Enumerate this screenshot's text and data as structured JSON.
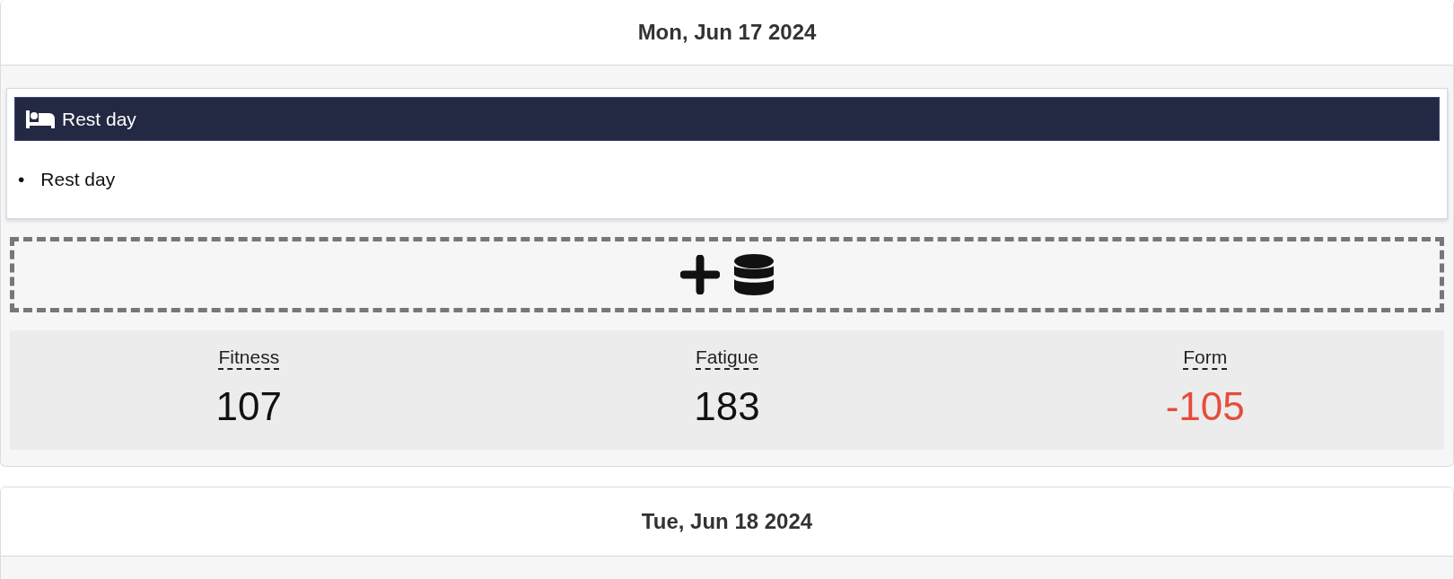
{
  "days": [
    {
      "date": "Mon, Jun 17 2024",
      "workouts": [
        {
          "kind": "rest",
          "title": "Rest day",
          "notes": [
            {
              "bullet": "•",
              "text": "Rest day"
            }
          ]
        }
      ],
      "add_actions": [
        {
          "kind": "add"
        },
        {
          "kind": "database"
        }
      ],
      "stats": [
        {
          "label": "Fitness",
          "value": "107",
          "color": "#111111"
        },
        {
          "label": "Fatigue",
          "value": "183",
          "color": "#111111"
        },
        {
          "label": "Form",
          "value": "-105",
          "color": "#e74c3c"
        }
      ]
    },
    {
      "date": "Tue, Jun 18 2024"
    }
  ]
}
